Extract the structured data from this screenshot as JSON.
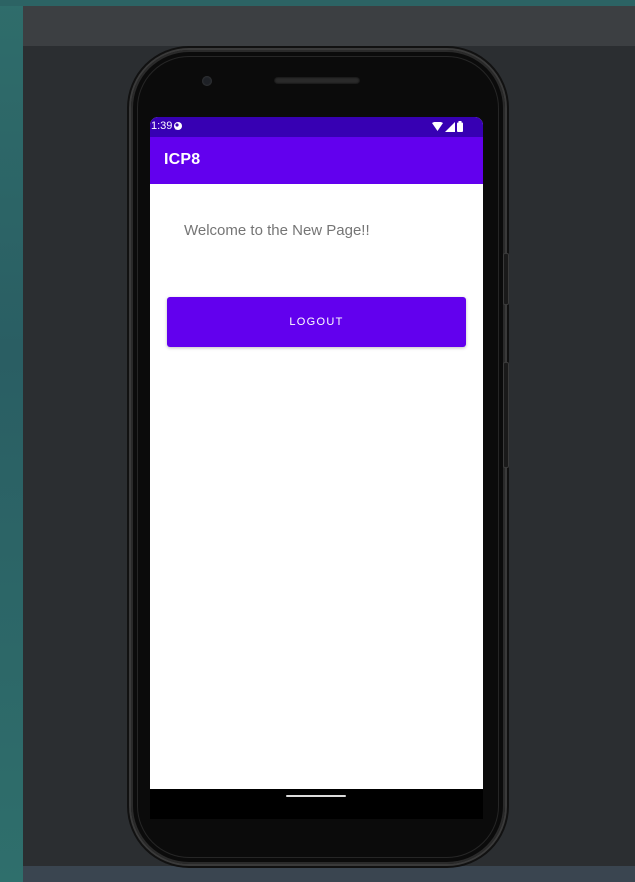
{
  "status_bar": {
    "time": "1:39",
    "notification_icon": "notification-icon",
    "wifi_icon": "wifi-icon",
    "signal_icon": "signal-icon",
    "battery_icon": "battery-icon"
  },
  "app_bar": {
    "title": "ICP8"
  },
  "main": {
    "welcome_text": "Welcome to the New Page!!",
    "logout_label": "LOGOUT"
  },
  "colors": {
    "primary": "#6200ee",
    "primary_dark": "#3700b3",
    "welcome_text": "#757575",
    "screen_background": "#ffffff"
  }
}
